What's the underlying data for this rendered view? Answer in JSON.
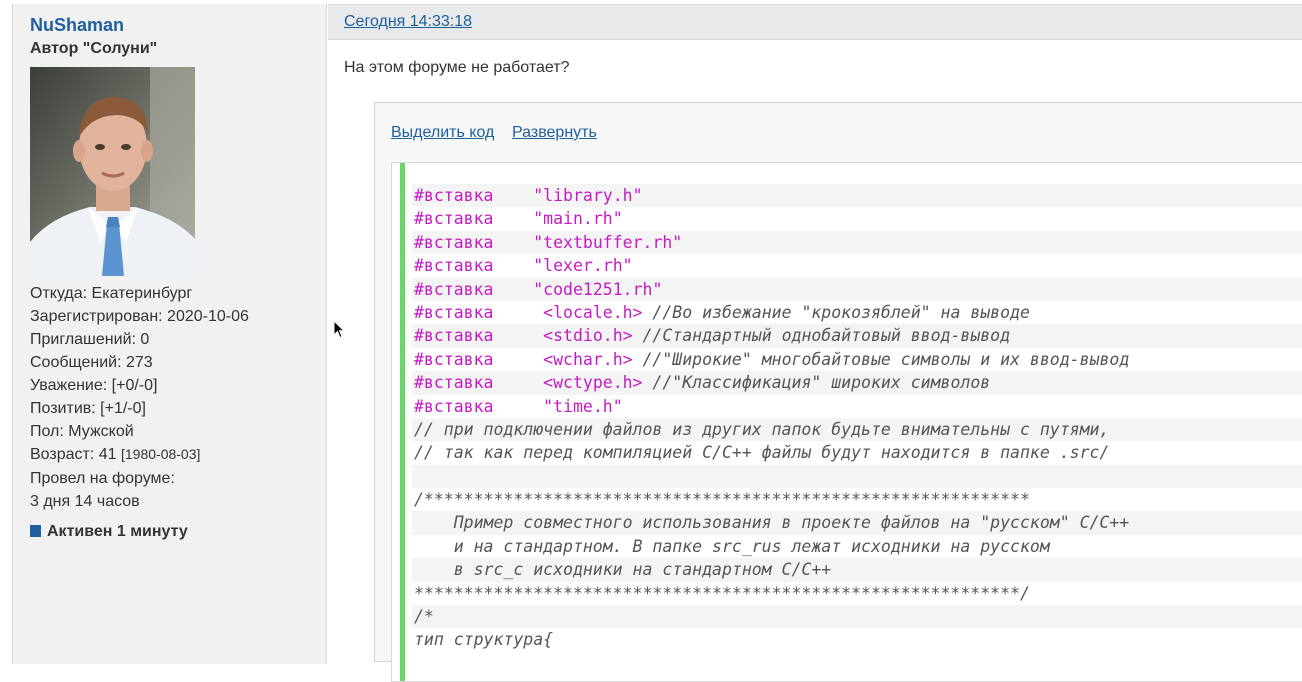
{
  "user": {
    "name": "NuShaman",
    "title": "Автор \"Солуни\"",
    "info": [
      {
        "label": "Откуда: ",
        "value": "Екатеринбург"
      },
      {
        "label": "Зарегистрирован: ",
        "value": "2020-10-06"
      },
      {
        "label": "Приглашений: ",
        "value": "0"
      },
      {
        "label": "Сообщений: ",
        "value": "273"
      },
      {
        "label": "Уважение: ",
        "value": "[+0/-0]"
      },
      {
        "label": "Позитив: ",
        "value": "[+1/-0]"
      },
      {
        "label": "Пол: ",
        "value": "Мужской"
      },
      {
        "label": "Возраст: ",
        "value": "41",
        "extra": "[1980-08-03]"
      },
      {
        "label": "Провел на форуме:",
        "value": ""
      },
      {
        "label": "",
        "value": "3 дня 14 часов"
      }
    ],
    "status": "Активен 1 минуту"
  },
  "post": {
    "date": "Сегодня 14:33:18",
    "text": "На этом форуме не работает?",
    "select_code": "Выделить код",
    "expand": "Развернуть"
  },
  "colors": {
    "link": "#1e5f9e",
    "keyword": "#c41bc4",
    "accent_bar": "#6ad66a"
  },
  "code": {
    "lines": [
      [
        {
          "t": "#вставка",
          "c": "kw"
        },
        {
          "t": "    ",
          "c": ""
        },
        {
          "t": "\"library.h\"",
          "c": "kw"
        }
      ],
      [
        {
          "t": "#вставка",
          "c": "kw"
        },
        {
          "t": "    ",
          "c": ""
        },
        {
          "t": "\"main.rh\"",
          "c": "kw"
        }
      ],
      [
        {
          "t": "#вставка",
          "c": "kw"
        },
        {
          "t": "    ",
          "c": ""
        },
        {
          "t": "\"textbuffer.rh\"",
          "c": "kw"
        }
      ],
      [
        {
          "t": "#вставка",
          "c": "kw"
        },
        {
          "t": "    ",
          "c": ""
        },
        {
          "t": "\"lexer.rh\"",
          "c": "kw"
        }
      ],
      [
        {
          "t": "#вставка",
          "c": "kw"
        },
        {
          "t": "    ",
          "c": ""
        },
        {
          "t": "\"code1251.rh\"",
          "c": "kw"
        }
      ],
      [
        {
          "t": "#вставка",
          "c": "kw"
        },
        {
          "t": "     ",
          "c": ""
        },
        {
          "t": "<locale.h>",
          "c": "kw"
        },
        {
          "t": " //Во избежание \"крокозяблей\" на выводе",
          "c": "cm"
        }
      ],
      [
        {
          "t": "#вставка",
          "c": "kw"
        },
        {
          "t": "     ",
          "c": ""
        },
        {
          "t": "<stdio.h>",
          "c": "kw"
        },
        {
          "t": " //Стандартный однобайтовый ввод-вывод",
          "c": "cm"
        }
      ],
      [
        {
          "t": "#вставка",
          "c": "kw"
        },
        {
          "t": "     ",
          "c": ""
        },
        {
          "t": "<wchar.h>",
          "c": "kw"
        },
        {
          "t": " //\"Широкие\" многобайтовые символы и их ввод-вывод",
          "c": "cm"
        }
      ],
      [
        {
          "t": "#вставка",
          "c": "kw"
        },
        {
          "t": "     ",
          "c": ""
        },
        {
          "t": "<wctype.h>",
          "c": "kw"
        },
        {
          "t": " //\"Классификация\" широких символов",
          "c": "cm"
        }
      ],
      [
        {
          "t": "#вставка",
          "c": "kw"
        },
        {
          "t": "     ",
          "c": ""
        },
        {
          "t": "\"time.h\"",
          "c": "kw"
        }
      ],
      [
        {
          "t": "// при подключении файлов из других папок будьте внимательны с путями,",
          "c": "cm"
        }
      ],
      [
        {
          "t": "// так как перед компиляцией С/С++ файлы будут находится в папке .src/",
          "c": "cm"
        }
      ],
      [
        {
          "t": "",
          "c": ""
        }
      ],
      [
        {
          "t": "/*************************************************************",
          "c": "cm"
        }
      ],
      [
        {
          "t": "    Пример совместного использования в проекте файлов на \"русском\" С/С++",
          "c": "cm"
        }
      ],
      [
        {
          "t": "    и на стандартном. В папке src_rus лежат исходники на русском",
          "c": "cm"
        }
      ],
      [
        {
          "t": "    в src_c исходники на стандартном С/С++",
          "c": "cm"
        }
      ],
      [
        {
          "t": "*************************************************************/",
          "c": "cm"
        }
      ],
      [
        {
          "t": "/*",
          "c": "cm"
        }
      ],
      [
        {
          "t": "тип структура{",
          "c": "cm"
        }
      ]
    ]
  }
}
